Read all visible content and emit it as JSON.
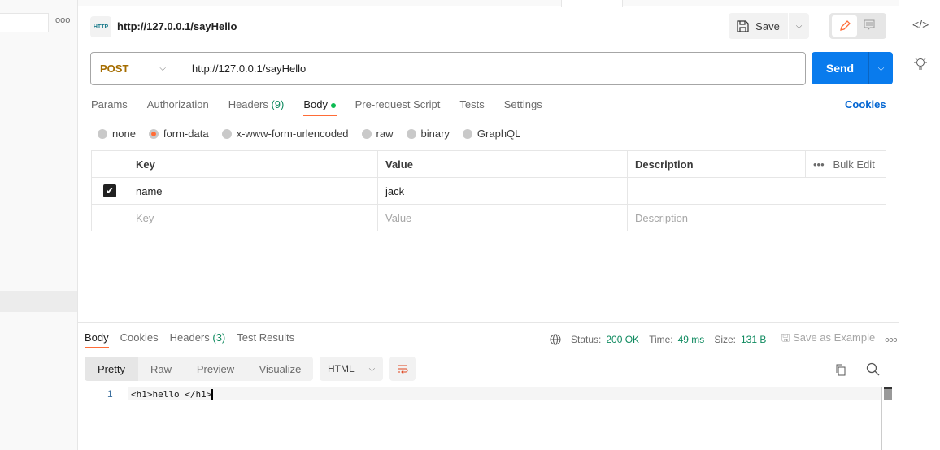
{
  "request": {
    "title": "http://127.0.0.1/sayHello",
    "method": "POST",
    "url": "http://127.0.0.1/sayHello",
    "save_label": "Save",
    "send_label": "Send",
    "cookies_label": "Cookies"
  },
  "tabs": [
    {
      "label": "Params"
    },
    {
      "label": "Authorization"
    },
    {
      "label": "Headers",
      "count": "(9)"
    },
    {
      "label": "Body"
    },
    {
      "label": "Pre-request Script"
    },
    {
      "label": "Tests"
    },
    {
      "label": "Settings"
    }
  ],
  "body_types": [
    "none",
    "form-data",
    "x-www-form-urlencoded",
    "raw",
    "binary",
    "GraphQL"
  ],
  "body_type_selected": "form-data",
  "table": {
    "headers": [
      "Key",
      "Value",
      "Description"
    ],
    "bulk_edit": "Bulk Edit",
    "rows": [
      {
        "checked": true,
        "key": "name",
        "value": "jack",
        "description": ""
      }
    ],
    "placeholders": {
      "key": "Key",
      "value": "Value",
      "description": "Description"
    }
  },
  "response": {
    "tabs": [
      "Body",
      "Cookies",
      "Headers",
      "Test Results"
    ],
    "headers_count": "(3)",
    "status_label": "Status:",
    "status": "200 OK",
    "time_label": "Time:",
    "time": "49 ms",
    "size_label": "Size:",
    "size": "131 B",
    "save_example": "Save as Example",
    "views": [
      "Pretty",
      "Raw",
      "Preview",
      "Visualize"
    ],
    "format": "HTML",
    "code": [
      {
        "line": "1",
        "text": "<h1>hello </h1>"
      }
    ]
  },
  "colors": {
    "accent": "#ff6c37",
    "send": "#097bed",
    "status_ok": "#0f8a5f",
    "link": "#0265d2"
  }
}
